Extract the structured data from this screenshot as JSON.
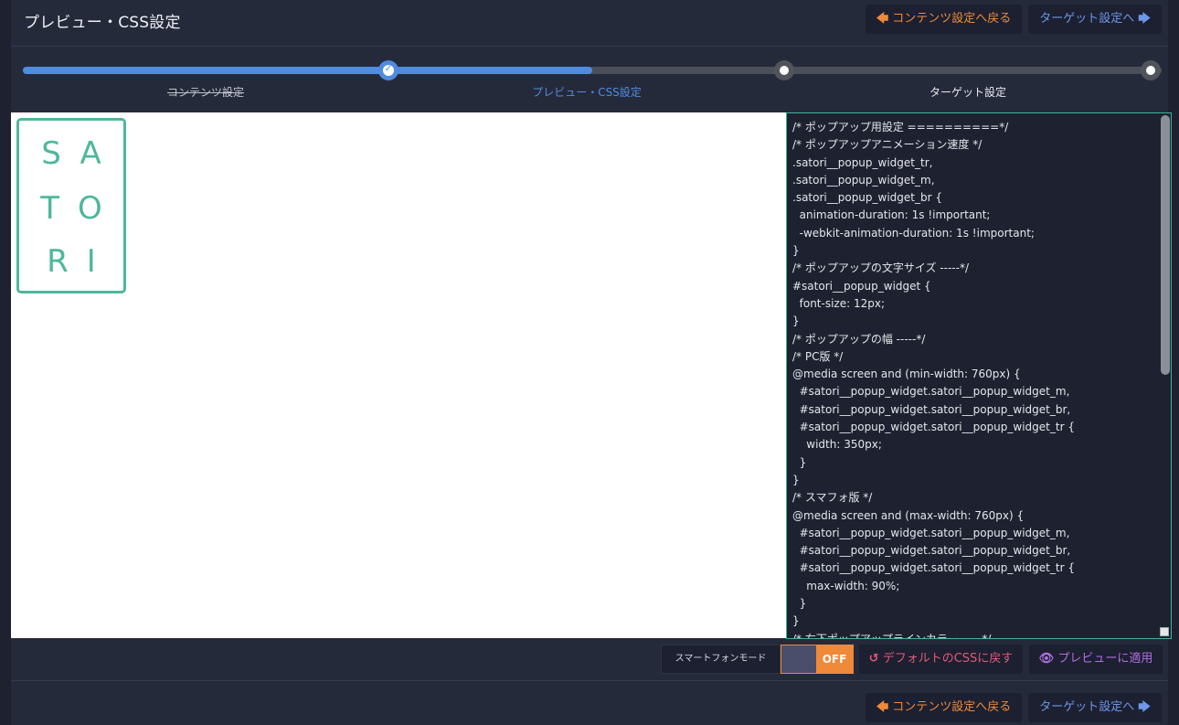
{
  "header": {
    "title": "プレビュー・CSS設定",
    "back_icon": "arrow-left-icon",
    "back_label": "コンテンツ設定へ戻る",
    "next_label": "ターゲット設定へ",
    "next_icon": "arrow-right-icon"
  },
  "steps": [
    {
      "label": "コンテンツ設定",
      "state": "done"
    },
    {
      "label": "プレビュー・CSS設定",
      "state": "active"
    },
    {
      "label": "ターゲット設定",
      "state": "todo"
    }
  ],
  "progress_fraction": 0.5,
  "preview": {
    "logo_rows": [
      "SA",
      "TO",
      "RI"
    ]
  },
  "editor": {
    "css": "/* ポップアップ用設定 ==========*/\n/* ポップアップアニメーション速度 */\n.satori__popup_widget_tr,\n.satori__popup_widget_m,\n.satori__popup_widget_br {\n  animation-duration: 1s !important;\n  -webkit-animation-duration: 1s !important;\n}\n/* ポップアップの文字サイズ -----*/\n#satori__popup_widget {\n  font-size: 12px;\n}\n/* ポップアップの幅 -----*/\n/* PC版 */\n@media screen and (min-width: 760px) {\n  #satori__popup_widget.satori__popup_widget_m,\n  #satori__popup_widget.satori__popup_widget_br,\n  #satori__popup_widget.satori__popup_widget_tr {\n    width: 350px;\n  }\n}\n/* スマフォ版 */\n@media screen and (max-width: 760px) {\n  #satori__popup_widget.satori__popup_widget_m,\n  #satori__popup_widget.satori__popup_widget_br,\n  #satori__popup_widget.satori__popup_widget_tr {\n    max-width: 90%;\n  }\n}\n/* 右下ポップアップラインカラー -----*/"
  },
  "toolbar": {
    "smartphone_mode_label": "スマートフォンモード",
    "toggle_state": "OFF",
    "reset_icon": "undo-icon",
    "reset_label": "デフォルトのCSSに戻す",
    "apply_icon": "eye-icon",
    "apply_label": "プレビューに適用"
  },
  "footer": {
    "back_label": "コンテンツ設定へ戻る",
    "next_label": "ターゲット設定へ"
  },
  "colors": {
    "accent_blue": "#4f8ce0",
    "accent_orange": "#ef8a3a",
    "logo_green": "#4fb79b",
    "reset_pink": "#e05a7a",
    "apply_purple": "#b06fe0"
  }
}
